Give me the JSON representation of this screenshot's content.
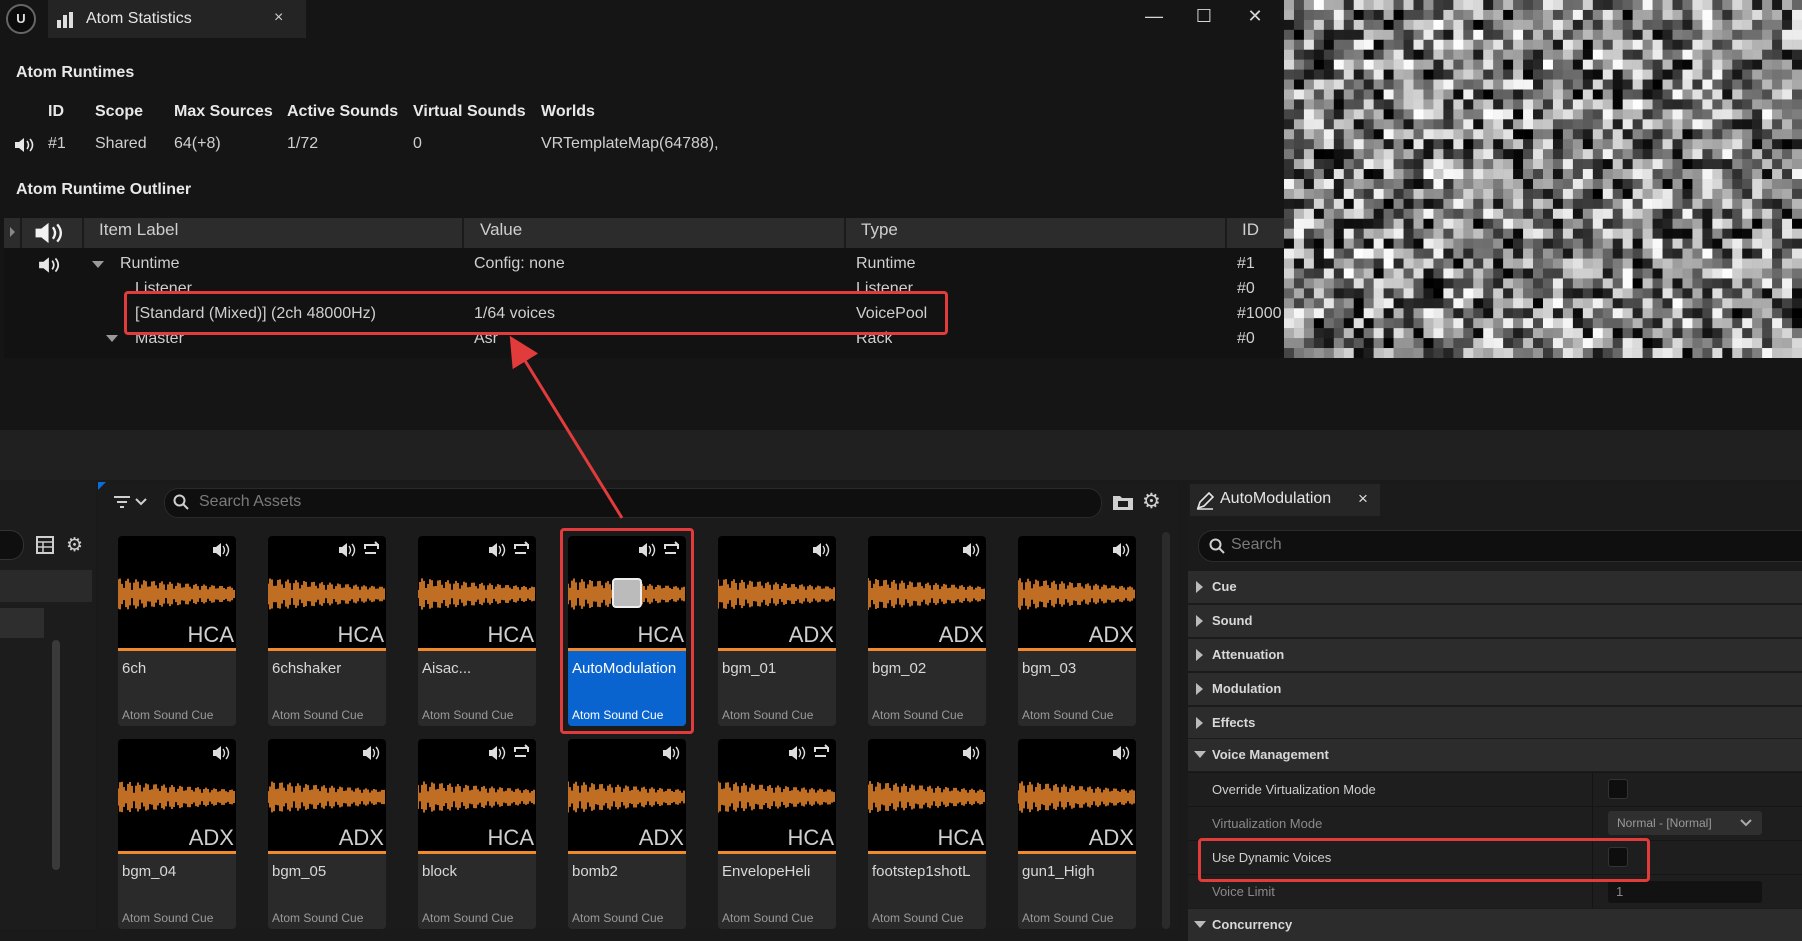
{
  "stats_window": {
    "tab_title": "Atom Statistics",
    "tab_close": "×",
    "controls": {
      "minimize": "—",
      "maximize": "☐",
      "close": "✕"
    },
    "runtimes_title": "Atom Runtimes",
    "runtimes_headers": [
      "ID",
      "Scope",
      "Max Sources",
      "Active Sounds",
      "Virtual Sounds",
      "Worlds"
    ],
    "runtimes_row": {
      "id": "#1",
      "scope": "Shared",
      "max_sources": "64(+8)",
      "active_sounds": "1/72",
      "virtual_sounds": "0",
      "worlds": "VRTemplateMap(64788),"
    },
    "outliner_title": "Atom Runtime Outliner",
    "outliner_headers": [
      "Item Label",
      "Value",
      "Type",
      "ID"
    ],
    "outliner_rows": [
      {
        "label": "Runtime",
        "value": "Config: none",
        "type": "Runtime",
        "id": "#1"
      },
      {
        "label": "Listener",
        "value": "",
        "type": "Listener",
        "id": "#0"
      },
      {
        "label": "[Standard (Mixed)]  (2ch 48000Hz)",
        "value": "1/64 voices",
        "type": "VoicePool",
        "id": "#1000"
      },
      {
        "label": "Master",
        "value": "Asr",
        "type": "Rack",
        "id": "#0"
      }
    ]
  },
  "content_browser": {
    "search_placeholder": "Search Assets",
    "assets": [
      {
        "name": "6ch",
        "type": "Atom Sound Cue",
        "codec": "HCA",
        "loop": false
      },
      {
        "name": "6chshaker",
        "type": "Atom Sound Cue",
        "codec": "HCA",
        "loop": true
      },
      {
        "name": "Aisac...",
        "type": "Atom Sound Cue",
        "codec": "HCA",
        "loop": true
      },
      {
        "name": "AutoModulation",
        "type": "Atom Sound Cue",
        "codec": "HCA",
        "loop": true,
        "selected": true
      },
      {
        "name": "bgm_01",
        "type": "Atom Sound Cue",
        "codec": "ADX",
        "loop": false
      },
      {
        "name": "bgm_02",
        "type": "Atom Sound Cue",
        "codec": "ADX",
        "loop": false
      },
      {
        "name": "bgm_03",
        "type": "Atom Sound Cue",
        "codec": "ADX",
        "loop": false
      },
      {
        "name": "bgm_04",
        "type": "Atom Sound Cue",
        "codec": "ADX",
        "loop": false
      },
      {
        "name": "bgm_05",
        "type": "Atom Sound Cue",
        "codec": "ADX",
        "loop": false
      },
      {
        "name": "block",
        "type": "Atom Sound Cue",
        "codec": "HCA",
        "loop": true
      },
      {
        "name": "bomb2",
        "type": "Atom Sound Cue",
        "codec": "ADX",
        "loop": false
      },
      {
        "name": "EnvelopeHeli",
        "type": "Atom Sound Cue",
        "codec": "HCA",
        "loop": true
      },
      {
        "name": "footstep1shotL",
        "type": "Atom Sound Cue",
        "codec": "HCA",
        "loop": false
      },
      {
        "name": "gun1_High",
        "type": "Atom Sound Cue",
        "codec": "ADX",
        "loop": false
      }
    ]
  },
  "details": {
    "tab_title": "AutoModulation",
    "tab_close": "×",
    "search_placeholder": "Search",
    "categories": [
      "Cue",
      "Sound",
      "Attenuation",
      "Modulation",
      "Effects"
    ],
    "voice_management": {
      "title": "Voice Management",
      "override_label": "Override Virtualization Mode",
      "virt_mode_label": "Virtualization Mode",
      "virt_mode_value": "Normal - [Normal]",
      "dynamic_voices_label": "Use Dynamic Voices",
      "voice_limit_label": "Voice Limit",
      "voice_limit_value": "1"
    },
    "concurrency_title": "Concurrency"
  },
  "colors": {
    "accent_orange": "#f08a2c",
    "selection_blue": "#0a64d0",
    "highlight_red": "#e23b3b"
  }
}
